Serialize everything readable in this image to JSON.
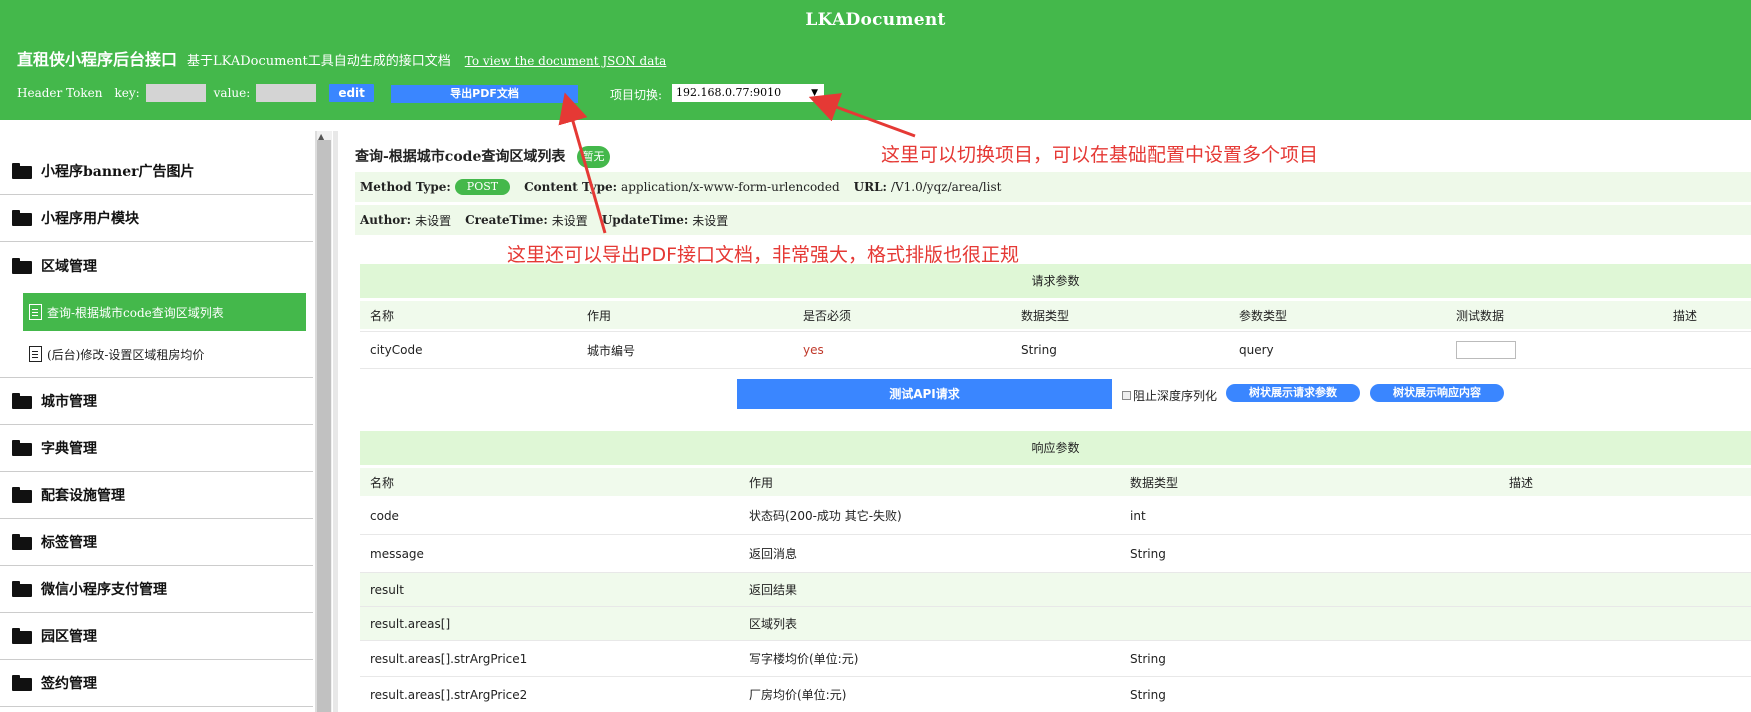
{
  "header": {
    "app_title": "LKADocument",
    "project_name": "直租侠小程序后台接口",
    "project_desc": "基于LKADocument工具自动生成的接口文档",
    "json_link": "To view the document JSON data",
    "token_label": "Header Token",
    "key_label": "key:",
    "value_label": "value:",
    "edit_label": "edit",
    "pdf_label": "导出PDF文档",
    "switch_label": "项目切换:",
    "switch_value": "192.168.0.77:9010"
  },
  "sidebar": {
    "items": [
      {
        "label": "小程序banner广告图片"
      },
      {
        "label": "小程序用户模块"
      },
      {
        "label": "区域管理"
      },
      {
        "label": "城市管理"
      },
      {
        "label": "字典管理"
      },
      {
        "label": "配套设施管理"
      },
      {
        "label": "标签管理"
      },
      {
        "label": "微信小程序支付管理"
      },
      {
        "label": "园区管理"
      },
      {
        "label": "签约管理"
      }
    ],
    "sub_items": [
      {
        "label": "查询-根据城市code查询区域列表"
      },
      {
        "label": "(后台)修改-设置区域租房均价"
      }
    ]
  },
  "api": {
    "title": "查询-根据城市code查询区域列表",
    "status": "暂无",
    "method_label": "Method Type:",
    "method": "POST",
    "content_type_label": "Content Type:",
    "content_type": "application/x-www-form-urlencoded",
    "url_label": "URL:",
    "url": "/V1.0/yqz/area/list",
    "author_label": "Author:",
    "author": "未设置",
    "create_label": "CreateTime:",
    "create": "未设置",
    "update_label": "UpdateTime:",
    "update": "未设置"
  },
  "request": {
    "title": "请求参数",
    "headers": [
      "名称",
      "作用",
      "是否必须",
      "数据类型",
      "参数类型",
      "测试数据",
      "描述"
    ],
    "rows": [
      {
        "name": "cityCode",
        "purpose": "城市编号",
        "required": "yes",
        "type": "String",
        "param_type": "query"
      }
    ]
  },
  "actions": {
    "test_label": "测试API请求",
    "deep_label": "阻止深度序列化",
    "tree_req_label": "树状展示请求参数",
    "tree_resp_label": "树状展示响应内容"
  },
  "response": {
    "title": "响应参数",
    "headers": [
      "名称",
      "作用",
      "数据类型",
      "描述"
    ],
    "rows": [
      {
        "name": "code",
        "purpose": "状态码(200-成功 其它-失败)",
        "type": "int"
      },
      {
        "name": "message",
        "purpose": "返回消息",
        "type": "String"
      },
      {
        "name": "result",
        "purpose": "返回结果",
        "type": ""
      },
      {
        "name": "result.areas[]",
        "purpose": "区域列表",
        "type": ""
      },
      {
        "name": "result.areas[].strArgPrice1",
        "purpose": "写字楼均价(单位:元)",
        "type": "String"
      },
      {
        "name": "result.areas[].strArgPrice2",
        "purpose": "厂房均价(单位:元)",
        "type": "String"
      }
    ]
  },
  "annotations": {
    "switch_note": "这里可以切换项目，可以在基础配置中设置多个项目",
    "pdf_note": "这里还可以导出PDF接口文档，非常强大，格式排版也很正规"
  },
  "colors": {
    "header_green": "#44b84b",
    "button_blue": "#3a86ff",
    "annotation_red": "#e53935"
  }
}
